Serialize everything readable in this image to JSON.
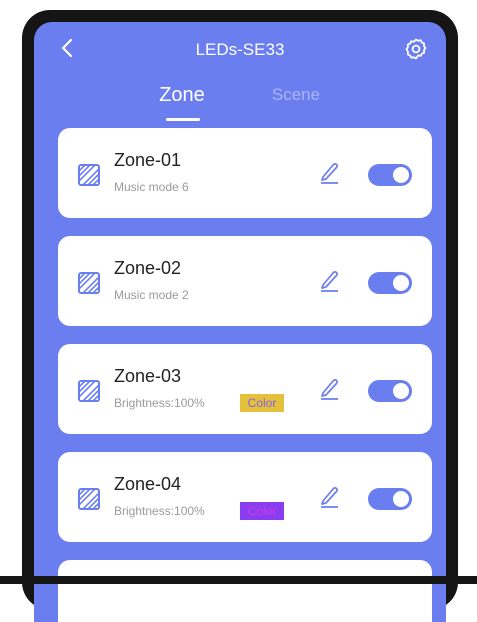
{
  "header": {
    "title": "LEDs-SE33",
    "back_icon": "chevron-left-icon",
    "settings_icon": "gear-icon"
  },
  "tabs": [
    {
      "label": "Zone",
      "active": true
    },
    {
      "label": "Scene",
      "active": false
    }
  ],
  "zones": [
    {
      "name": "Zone-01",
      "subtitle": "Music mode 6",
      "enabled": true
    },
    {
      "name": "Zone-02",
      "subtitle": "Music mode 2",
      "enabled": true
    },
    {
      "name": "Zone-03",
      "subtitle": "Brightness:100%",
      "color_tag": "Color",
      "color_tag_bg": "#e3c13a",
      "color_tag_fg": "#8a5cf0",
      "enabled": true
    },
    {
      "name": "Zone-04",
      "subtitle": "Brightness:100%",
      "color_tag": "Color",
      "color_tag_bg": "#8a3cf0",
      "color_tag_fg": "#d13adf",
      "enabled": true
    }
  ],
  "colors": {
    "accent": "#6a7ef0",
    "card": "#ffffff",
    "frame": "#151515"
  }
}
